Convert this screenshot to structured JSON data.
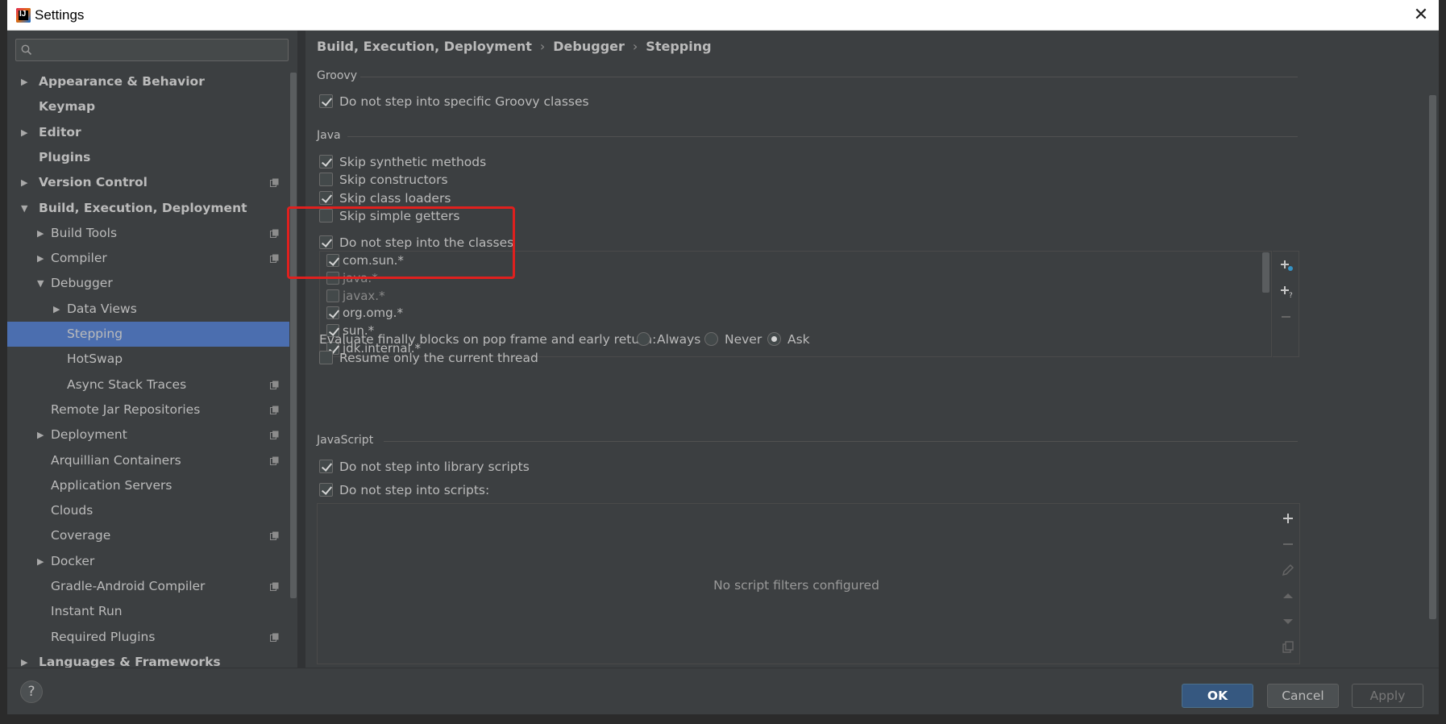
{
  "window": {
    "title": "Settings",
    "close_glyph": "✕"
  },
  "search": {
    "placeholder": "",
    "value": ""
  },
  "tree": [
    {
      "label": "Appearance & Behavior",
      "level": 0,
      "expander": "collapsed",
      "bold": true
    },
    {
      "label": "Keymap",
      "level": 0,
      "expander": "none",
      "bold": true
    },
    {
      "label": "Editor",
      "level": 0,
      "expander": "collapsed",
      "bold": true
    },
    {
      "label": "Plugins",
      "level": 0,
      "expander": "none",
      "bold": true
    },
    {
      "label": "Version Control",
      "level": 0,
      "expander": "collapsed",
      "bold": true,
      "project_icon": true
    },
    {
      "label": "Build, Execution, Deployment",
      "level": 0,
      "expander": "expanded",
      "bold": true
    },
    {
      "label": "Build Tools",
      "level": 1,
      "expander": "collapsed",
      "project_icon": true
    },
    {
      "label": "Compiler",
      "level": 1,
      "expander": "collapsed",
      "project_icon": true
    },
    {
      "label": "Debugger",
      "level": 1,
      "expander": "expanded"
    },
    {
      "label": "Data Views",
      "level": 2,
      "expander": "collapsed"
    },
    {
      "label": "Stepping",
      "level": 2,
      "expander": "none",
      "selected": true
    },
    {
      "label": "HotSwap",
      "level": 2,
      "expander": "none"
    },
    {
      "label": "Async Stack Traces",
      "level": 2,
      "expander": "none",
      "project_icon": true
    },
    {
      "label": "Remote Jar Repositories",
      "level": 1,
      "expander": "none",
      "project_icon": true
    },
    {
      "label": "Deployment",
      "level": 1,
      "expander": "collapsed",
      "project_icon": true
    },
    {
      "label": "Arquillian Containers",
      "level": 1,
      "expander": "none",
      "project_icon": true
    },
    {
      "label": "Application Servers",
      "level": 1,
      "expander": "none"
    },
    {
      "label": "Clouds",
      "level": 1,
      "expander": "none"
    },
    {
      "label": "Coverage",
      "level": 1,
      "expander": "none",
      "project_icon": true
    },
    {
      "label": "Docker",
      "level": 1,
      "expander": "collapsed"
    },
    {
      "label": "Gradle-Android Compiler",
      "level": 1,
      "expander": "none",
      "project_icon": true
    },
    {
      "label": "Instant Run",
      "level": 1,
      "expander": "none"
    },
    {
      "label": "Required Plugins",
      "level": 1,
      "expander": "none",
      "project_icon": true
    },
    {
      "label": "Languages & Frameworks",
      "level": 0,
      "expander": "collapsed",
      "bold": true
    }
  ],
  "breadcrumb": [
    "Build, Execution, Deployment",
    "Debugger",
    "Stepping"
  ],
  "breadcrumb_separator": "›",
  "groovy": {
    "title": "Groovy",
    "items": [
      {
        "label": "Do not step into specific Groovy classes",
        "checked": true
      }
    ]
  },
  "java": {
    "title": "Java",
    "items": [
      {
        "label": "Skip synthetic methods",
        "checked": true
      },
      {
        "label": "Skip constructors",
        "checked": false
      },
      {
        "label": "Skip class loaders",
        "checked": true
      },
      {
        "label": "Skip simple getters",
        "checked": false
      },
      {
        "label": "Do not step into the classes",
        "checked": true
      }
    ],
    "classes": [
      {
        "label": "com.sun.*",
        "checked": true,
        "enabled": true
      },
      {
        "label": "java.*",
        "checked": false,
        "enabled": false
      },
      {
        "label": "javax.*",
        "checked": false,
        "enabled": false
      },
      {
        "label": "org.omg.*",
        "checked": true,
        "enabled": true
      },
      {
        "label": "sun.*",
        "checked": true,
        "enabled": true
      },
      {
        "label": "jdk.internal.*",
        "checked": true,
        "enabled": true
      }
    ],
    "evaluate_finally": {
      "label": "Evaluate finally blocks on pop frame and early return:",
      "options": [
        "Always",
        "Never",
        "Ask"
      ],
      "selected": "Ask"
    },
    "resume_current_thread": {
      "label": "Resume only the current thread",
      "checked": false
    }
  },
  "javascript": {
    "title": "JavaScript",
    "items": [
      {
        "label": "Do not step into library scripts",
        "checked": true
      },
      {
        "label": "Do not step into scripts:",
        "checked": true
      }
    ],
    "empty_text": "No script filters configured"
  },
  "footer": {
    "help_label": "?",
    "ok_label": "OK",
    "cancel_label": "Cancel",
    "apply_label": "Apply"
  },
  "colors": {
    "background": "#3c3f41",
    "selection": "#4b6eaf",
    "highlight_box": "#e0201e",
    "ok_button": "#365880"
  }
}
